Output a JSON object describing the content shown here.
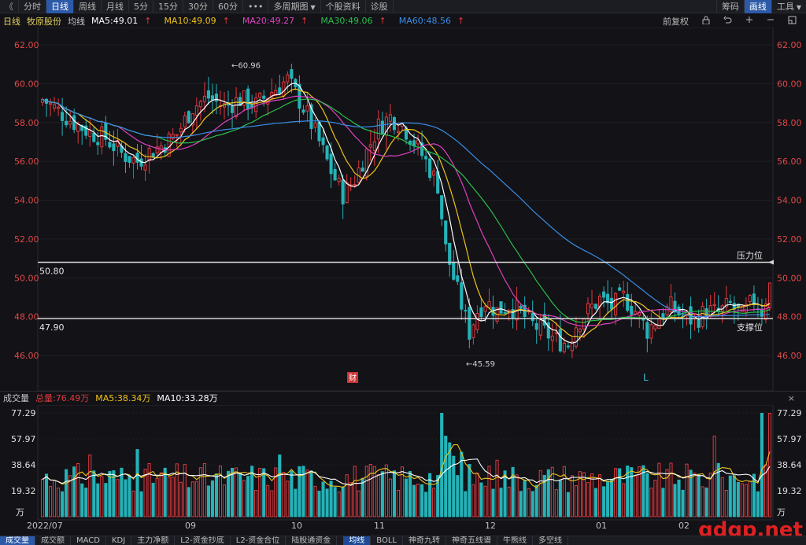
{
  "toolbar": {
    "back": "《",
    "tabs": [
      "分时",
      "日线",
      "周线",
      "月线",
      "5分",
      "15分",
      "30分",
      "60分"
    ],
    "active_tab": 1,
    "more": "•••",
    "multi_period": "多周期图",
    "stock_info": "个股资料",
    "diagnose": "诊股",
    "right": [
      "筹码",
      "画线",
      "工具"
    ],
    "right_active": 1
  },
  "info": {
    "period": "日线",
    "stock_name": "牧原股份",
    "ma_label": "均线",
    "ma5": "MA5:49.01",
    "ma10": "MA10:49.09",
    "ma20": "MA20:49.27",
    "ma30": "MA30:49.06",
    "ma60": "MA60:48.56",
    "right_label": "前复权"
  },
  "colors": {
    "up": "#e03a3e",
    "down": "#25b3b8",
    "ma5": "#ffffff",
    "ma10": "#f0c419",
    "ma20": "#e040c0",
    "ma30": "#2bc04a",
    "ma60": "#3a8ee6",
    "axis_text": "#e04848"
  },
  "chart_data": {
    "type": "candlestick",
    "y_ticks": [
      "62.00",
      "60.00",
      "58.00",
      "56.00",
      "54.00",
      "52.00",
      "50.00",
      "48.00",
      "46.00"
    ],
    "ylim": [
      45.0,
      62.5
    ],
    "resistance": {
      "value": 50.8,
      "label": "50.80",
      "name": "压力位"
    },
    "support": {
      "value": 47.9,
      "label": "47.90",
      "name": "支撑位"
    },
    "high_marker": "←60.96",
    "low_marker": "←45.59",
    "event_marker": "财",
    "l_marker": "L"
  },
  "volume": {
    "label": "成交量",
    "total": "总量:76.49万",
    "ma5": "MA5:38.34万",
    "ma10": "MA10:33.28万",
    "y_ticks": [
      "77.29",
      "57.97",
      "38.64",
      "19.32"
    ],
    "unit": "万",
    "ylim": [
      0,
      80
    ]
  },
  "dates": [
    "2022/07",
    "09",
    "10",
    "11",
    "12",
    "01",
    "02"
  ],
  "bottom_tabs": [
    "成交量",
    "成交额",
    "MACD",
    "KDJ",
    "主力净额",
    "L2-资金抄底",
    "L2-资金合位",
    "陆股通资金"
  ],
  "bottom_tabs2": [
    "均线",
    "BOLL",
    "神奇九转",
    "神奇五线谱",
    "牛熊线",
    "多空线"
  ],
  "watermark": "gdgp.net"
}
